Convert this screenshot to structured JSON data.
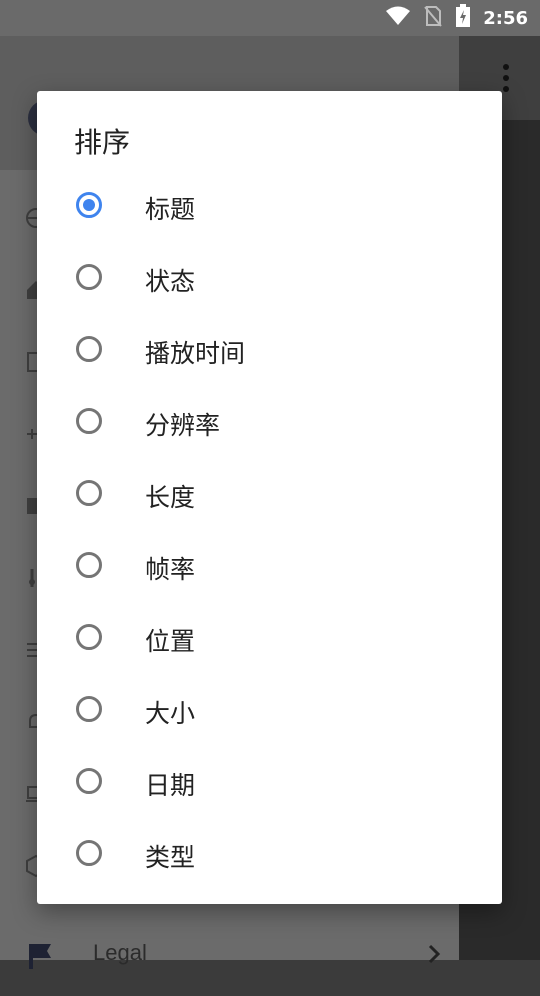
{
  "status_bar": {
    "time": "2:56",
    "icons": [
      "wifi-icon",
      "no-sim-icon",
      "battery-charging-icon"
    ]
  },
  "app": {
    "drawer_legal_label": "Legal"
  },
  "dialog": {
    "title": "排序",
    "accent_color": "#3f84ee",
    "selected": "标题",
    "options": [
      {
        "label": "标题",
        "checked": true
      },
      {
        "label": "状态",
        "checked": false
      },
      {
        "label": "播放时间",
        "checked": false
      },
      {
        "label": "分辨率",
        "checked": false
      },
      {
        "label": "长度",
        "checked": false
      },
      {
        "label": "帧率",
        "checked": false
      },
      {
        "label": "位置",
        "checked": false
      },
      {
        "label": "大小",
        "checked": false
      },
      {
        "label": "日期",
        "checked": false
      },
      {
        "label": "类型",
        "checked": false
      }
    ]
  }
}
